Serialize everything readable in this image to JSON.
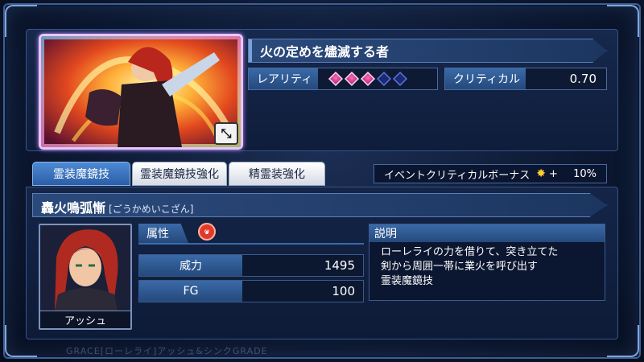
{
  "card": {
    "title": "火の定めを燼滅する者",
    "rarity_label": "レアリティ",
    "rarity_filled": 3,
    "rarity_total": 5,
    "critical_label": "クリティカル",
    "critical_value": "0.70",
    "expand_icon": "expand-arrows-icon"
  },
  "tabs": [
    {
      "label": "霊装魔鏡技",
      "active": true
    },
    {
      "label": "霊装魔鏡技強化",
      "active": false
    },
    {
      "label": "精霊装強化",
      "active": false
    }
  ],
  "bonus": {
    "label": "イベントクリティカルボーナス",
    "icon": "spark-icon",
    "plus": "+",
    "value": "10%"
  },
  "skill": {
    "name": "轟火鳴弧慚",
    "reading": "[ごうかめいこざん]",
    "attribute_label": "属性",
    "attribute_icon": "fire-element-icon",
    "power_label": "威力",
    "power_value": "1495",
    "fg_label": "FG",
    "fg_value": "100",
    "description_header": "説明",
    "description_lines": [
      "ローレライの力を借りて、突き立てた",
      "剣から周囲一帯に業火を呼び出す",
      "霊装魔鏡技"
    ]
  },
  "character": {
    "name": "アッシュ"
  },
  "watermark": "GRACE[ローレライ]アッシュ&シンクGRADE"
}
